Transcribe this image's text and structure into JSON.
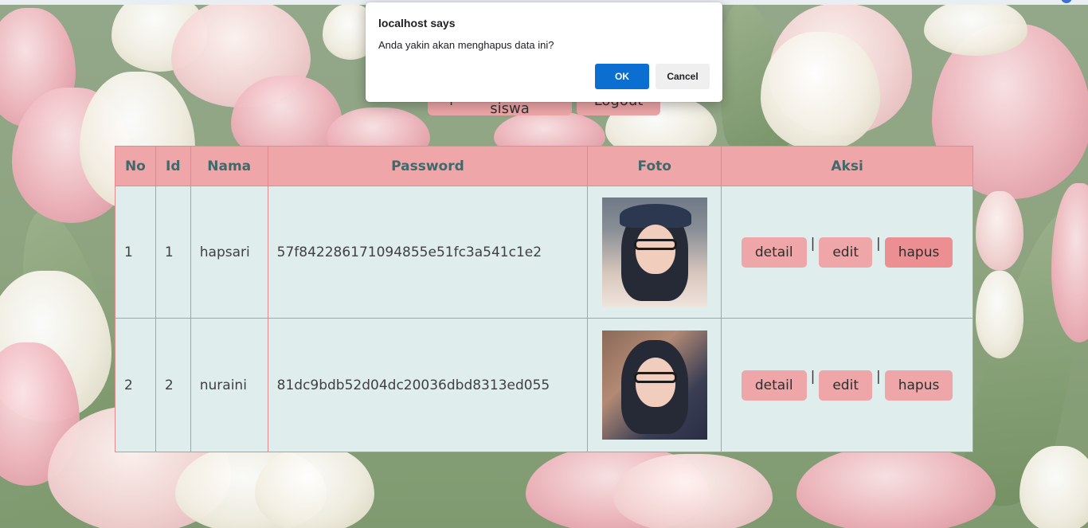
{
  "dialog": {
    "title": "localhost says",
    "message": "Anda yakin akan menghapus data ini?",
    "ok_label": "OK",
    "cancel_label": "Cancel"
  },
  "nav": {
    "add_label": "Tambah siswa",
    "logout_label": "Logout"
  },
  "table": {
    "headers": [
      "No",
      "Id",
      "Nama",
      "Password",
      "Foto",
      "Aksi"
    ],
    "rows": [
      {
        "no": "1",
        "id": "1",
        "nama": "hapsari",
        "password": "57f842286171094855e51fc3a541c1e2"
      },
      {
        "no": "2",
        "id": "2",
        "nama": "nuraini",
        "password": "81dc9bdb52d04dc20036dbd8313ed055"
      }
    ],
    "actions": {
      "detail": "detail",
      "edit": "edit",
      "hapus": "hapus",
      "separator": "|"
    }
  },
  "colors": {
    "header_bg": "#eea6a8",
    "header_text": "#3f6a6b",
    "cell_bg": "#dfeeed",
    "border": "#e48a8d",
    "ok_button": "#0b6ed1"
  }
}
